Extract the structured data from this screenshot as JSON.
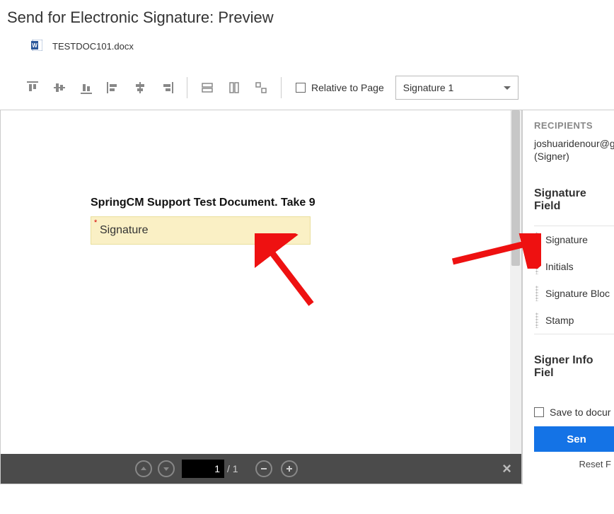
{
  "header": {
    "title": "Send for Electronic Signature: Preview",
    "filename": "TESTDOC101.docx"
  },
  "toolbar": {
    "relative_label": "Relative to Page",
    "signer_selected": "Signature 1"
  },
  "document": {
    "body_text": "SpringCM Support Test Document.  Take 9",
    "signature_field_label": "Signature"
  },
  "footer": {
    "page_current": "1",
    "page_total": "/ 1"
  },
  "sidebar": {
    "recipients_heading": "RECIPIENTS",
    "recipient_email": "joshuaridenour@g",
    "recipient_role": "(Signer)",
    "sig_fields_heading": "Signature Field",
    "fields": [
      {
        "label": "Signature"
      },
      {
        "label": "Initials"
      },
      {
        "label": "Signature Bloc"
      },
      {
        "label": "Stamp"
      }
    ],
    "signer_info_heading": "Signer Info Fiel",
    "save_label": "Save to docur",
    "send_label": "Sen",
    "reset_label": "Reset F"
  }
}
